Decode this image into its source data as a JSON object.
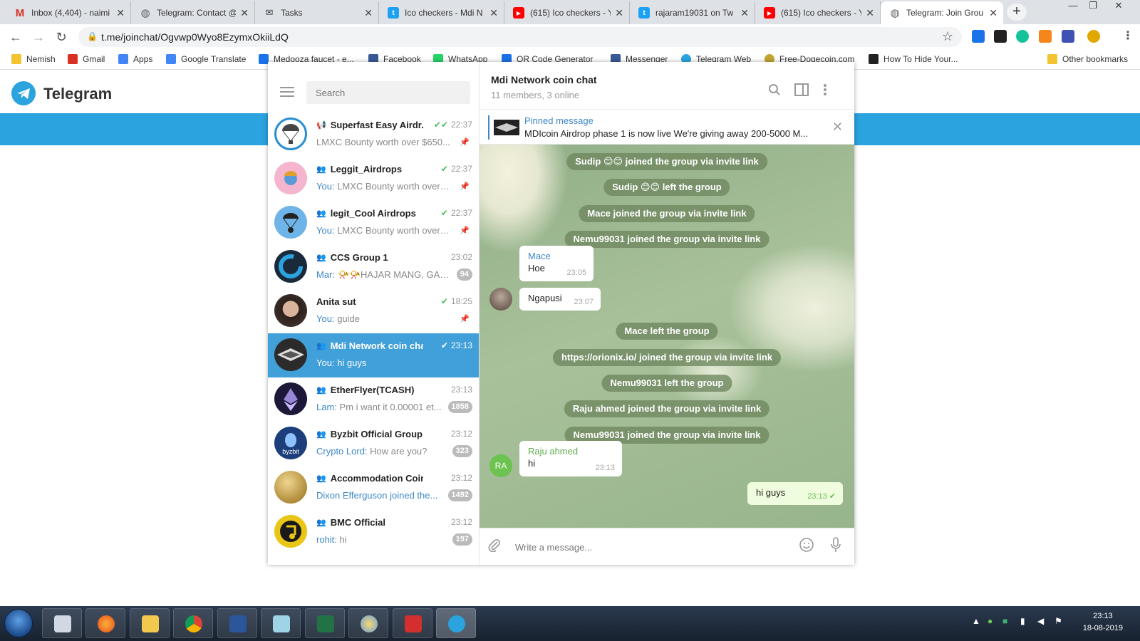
{
  "browser": {
    "tabs": [
      {
        "title": "Inbox (4,404) - naimi",
        "icon": "gmail-icon",
        "color": "#d93025",
        "glyph": "M",
        "close": "✕"
      },
      {
        "title": "Telegram: Contact @",
        "icon": "globe-icon",
        "color": "#5f6368",
        "glyph": "◍",
        "close": "✕"
      },
      {
        "title": "Tasks",
        "icon": "tasks-icon",
        "color": "#3c4043",
        "glyph": "✉",
        "close": "✕"
      },
      {
        "title": "Ico checkers - Mdi N",
        "icon": "twitter-icon",
        "color": "#1da1f2",
        "glyph": "t",
        "close": "✕"
      },
      {
        "title": "(615) Ico checkers - Y",
        "icon": "youtube-icon",
        "color": "#ff0000",
        "glyph": "▶",
        "close": "✕"
      },
      {
        "title": "rajaram19031 on Tw",
        "icon": "twitter-icon",
        "color": "#1da1f2",
        "glyph": "t",
        "close": "✕"
      },
      {
        "title": "(615) Ico checkers - Y",
        "icon": "youtube-icon",
        "color": "#ff0000",
        "glyph": "▶",
        "close": "✕"
      },
      {
        "title": "Telegram: Join Grou",
        "icon": "globe-icon",
        "color": "#5f6368",
        "glyph": "◍",
        "close": "✕"
      }
    ],
    "new_tab": "+",
    "window_controls": [
      "—",
      "❐",
      "✕"
    ],
    "nav": {
      "back": "←",
      "forward": "→",
      "reload": "↻"
    },
    "url": "t.me/joinchat/Ogvwp0Wyo8EzymxOkiiLdQ",
    "lock": "🔒",
    "star": "☆",
    "bookmarks": [
      {
        "label": "Nemish",
        "color": "#f4c430"
      },
      {
        "label": "Gmail",
        "color": "#d93025"
      },
      {
        "label": "Apps",
        "color": "#4285f4"
      },
      {
        "label": "Google Translate",
        "color": "#4285f4"
      },
      {
        "label": "Medooza faucet - e...",
        "color": "#1a73e8"
      },
      {
        "label": "Facebook",
        "color": "#3b5998"
      },
      {
        "label": "WhatsApp",
        "color": "#25d366"
      },
      {
        "label": "QR Code Generator",
        "color": "#1a73e8"
      },
      {
        "label": "Messenger",
        "color": "#3b5998"
      },
      {
        "label": "Telegram Web",
        "color": "#2aa3df"
      },
      {
        "label": "Free-Dogecoin.com",
        "color": "#c2a633"
      },
      {
        "label": "How To Hide Your...",
        "color": "#222222"
      }
    ],
    "other_bookmarks": "Other bookmarks"
  },
  "page": {
    "brand": "Telegram"
  },
  "telegram": {
    "search_placeholder": "Search",
    "window_controls": [
      "—",
      "☐",
      "✕"
    ],
    "chats": [
      {
        "name": "Superfast Easy Airdr...",
        "type": "channel",
        "time": "22:37",
        "check": "✔✔",
        "sender": "",
        "preview": "LMXC Bounty worth over $650...",
        "badge": "",
        "pinned": true,
        "avatar": "#ffffff",
        "avatar_border": "#2a8fd0"
      },
      {
        "name": "Leggit_Airdrops",
        "type": "group",
        "time": "22:37",
        "check": "✔",
        "sender": "You:",
        "preview": "LMXC Bounty worth over ...",
        "badge": "",
        "pinned": true,
        "avatar": "#f5b5cf",
        "avatar_border": ""
      },
      {
        "name": "legit_Cool Airdrops",
        "type": "group",
        "time": "22:37",
        "check": "✔",
        "sender": "You:",
        "preview": "LMXC Bounty worth over ...",
        "badge": "",
        "pinned": true,
        "avatar": "#6fb4e8",
        "avatar_border": ""
      },
      {
        "name": "CCS Group 1",
        "type": "group",
        "time": "23:02",
        "check": "",
        "sender": "Mar:",
        "preview": "📯📯HAJAR MANG, GAR...",
        "badge": "94",
        "pinned": false,
        "avatar": "#1b2a3a",
        "avatar_border": ""
      },
      {
        "name": "Anita sut",
        "type": "user",
        "time": "18:25",
        "check": "✔",
        "sender": "You:",
        "preview": "guide",
        "badge": "",
        "pinned": true,
        "avatar": "#4a3b35",
        "avatar_border": ""
      },
      {
        "name": "Mdi Network coin chat",
        "type": "group",
        "time": "23:13",
        "check": "✔",
        "sender": "You:",
        "preview": "hi guys",
        "badge": "",
        "pinned": false,
        "avatar": "#2b2b2b",
        "avatar_border": "",
        "active": true
      },
      {
        "name": "EtherFlyer(TCASH)",
        "type": "group",
        "time": "23:13",
        "check": "",
        "sender": "Lam:",
        "preview": "Pm i want it 0.00001 et...",
        "badge": "1858",
        "pinned": false,
        "avatar": "#1d1838",
        "avatar_border": ""
      },
      {
        "name": "Byzbit Official Group",
        "type": "group",
        "time": "23:12",
        "check": "",
        "sender": "Crypto Lord:",
        "preview": "How are you?",
        "badge": "323",
        "pinned": false,
        "avatar": "#1c3f7c",
        "avatar_border": ""
      },
      {
        "name": "Accommodation Coin",
        "type": "group",
        "time": "23:12",
        "check": "",
        "sender": "Dixon Efferguson joined the...",
        "preview": "",
        "badge": "1492",
        "pinned": false,
        "avatar": "#c9a24e",
        "avatar_border": ""
      },
      {
        "name": "BMC Official",
        "type": "group",
        "time": "23:12",
        "check": "",
        "sender": "rohit:",
        "preview": "hi",
        "badge": "197",
        "pinned": false,
        "avatar": "#e9c516",
        "avatar_border": ""
      }
    ],
    "header": {
      "title": "Mdi Network coin chat",
      "subtitle": "11 members, 3 online"
    },
    "pinned": {
      "label": "Pinned message",
      "text": "MDIcoin Airdrop phase 1 is now live We're giving away 200-5000 M...",
      "close": "✕"
    },
    "messages": {
      "svc": [
        "Sudip 😊😊 joined the group via invite link",
        "Sudip 😊😊 left the group",
        "Mace joined the group via invite link",
        "Nemu99031 joined the group via invite link",
        "Mace left the group",
        "https://orionix.io/ joined the group via invite link",
        "Nemu99031 left the group",
        "Raju ahmed joined the group via invite link",
        "Nemu99031 joined the group via invite link"
      ],
      "mace": {
        "name": "Mace",
        "text": "Hoe",
        "time": "23:05",
        "name_color": "#3e88c5"
      },
      "ngapusi": {
        "text": "Ngapusi",
        "time": "23:07"
      },
      "raju": {
        "name": "Raju ahmed",
        "text": "hi",
        "time": "23:13",
        "initials": "RA",
        "name_color": "#5caf4a"
      },
      "mine": {
        "text": "hi guys",
        "time": "23:13",
        "check": "✔"
      }
    },
    "composer": {
      "placeholder": "Write a message..."
    }
  },
  "taskbar": {
    "time": "23:13",
    "date": "18-08-2019"
  }
}
